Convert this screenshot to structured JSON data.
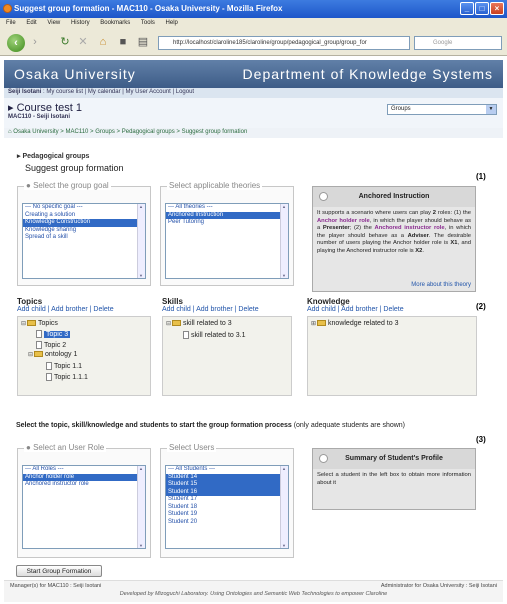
{
  "window": {
    "title": "Suggest group formation - MAC110 - Osaka University - Mozilla Firefox"
  },
  "menu": [
    "File",
    "Edit",
    "View",
    "History",
    "Bookmarks",
    "Tools",
    "Help"
  ],
  "browser": {
    "url": "http://localhost/claroline185/claroline/group/pedagogical_group/group_for",
    "search_placeholder": "Google"
  },
  "header": {
    "left": "Osaka University",
    "right": "Department of Knowledge Systems"
  },
  "userbar": {
    "user": "Seiji Isotani",
    "sep": " : ",
    "links": "My course list | My calendar | My User Account | Logout"
  },
  "course": {
    "title": "Course test 1",
    "subtitle": "MAC110 - Seiji Isotani",
    "select_value": "Groups"
  },
  "breadcrumb": "Osaka University > MAC110 > Groups > Pedagogical groups > Suggest group formation",
  "page": {
    "title": "Pedagogical groups",
    "subtitle": "Suggest group formation"
  },
  "annotations": {
    "a1": "(1)",
    "a2": "(2)",
    "a3": "(3)"
  },
  "goal": {
    "legend": "Select the group goal",
    "options": [
      "--- No specific goal ---",
      "Creating a solution",
      "Knowledge Construction",
      "Knowledge sharing",
      "Spread of a skill"
    ],
    "selected_index": 2
  },
  "theories": {
    "legend": "Select applicable theories",
    "options": [
      "--- All theories ---",
      "Anchored Instruction",
      "Peer Tutoring"
    ],
    "selected_index": 1
  },
  "theory_info": {
    "title": "Anchored Instruction",
    "t1": "It supports a scenario where users can play ",
    "n2": "2",
    "t2": " roles: (1) the ",
    "r1": "Anchor holder role",
    "t3": ", in which the player should behave as a ",
    "b1": "Presenter",
    "t4": "; (2) the ",
    "r2": "Anchored instructor role",
    "t5": ", in which the player should behave as a ",
    "b2": "Adviser",
    "t6": ". The desirable number of users playing the Anchor holder role is ",
    "x1": "X1",
    "t7": ", and playing the Anchored instructor role is ",
    "x2": "X2",
    "t8": ".",
    "more": "More about this theory"
  },
  "topics": {
    "header": "Topics",
    "links": "Add child | Add brother | Delete",
    "nodes": [
      "Topics",
      "Topic 3",
      "Topic 2",
      "ontology 1",
      "Topic 1.1",
      "Topic 1.1.1"
    ]
  },
  "skills": {
    "header": "Skills",
    "links": "Add child | Add brother | Delete",
    "nodes": [
      "skill related to 3",
      "skill related to 3.1"
    ]
  },
  "knowledge": {
    "header": "Knowledge",
    "links": "Add child | Add brother | Delete",
    "nodes": [
      "knowledge related to 3"
    ]
  },
  "select_line": {
    "bold": "Select the topic, skill/knowledge and students to start the group formation process",
    "normal": " (only adequate students are shown)"
  },
  "roles": {
    "legend": "Select an User Role",
    "options": [
      "--- All Roles ---",
      "Anchor holder role",
      "Anchored instructor role"
    ],
    "selected_index": 1
  },
  "users": {
    "legend": "Select Users",
    "options": [
      "--- All Students ---",
      "Student 14",
      "Student 15",
      "Student 16",
      "Student 17",
      "Student 18",
      "Student 19",
      "Student 20"
    ],
    "selected": [
      1,
      2,
      3
    ]
  },
  "student_profile": {
    "title": "Summary of Student's Profile",
    "body": "Select a student in the left box to obtain more information about it"
  },
  "start_button": "Start Group Formation",
  "footer": {
    "left": "Manager(s) for MAC110 : Seiji Isotani",
    "right": "Administrator for Osaka University : Seiji Isotani",
    "center": "Developed by Mizoguchi Laboratory. Using Ontologies and Semantic Web Technologies to empower Claroline"
  },
  "colors": {
    "header_bg": "#4a6b96",
    "selection": "#316ac5",
    "role_purple": "#8a2b8f"
  }
}
